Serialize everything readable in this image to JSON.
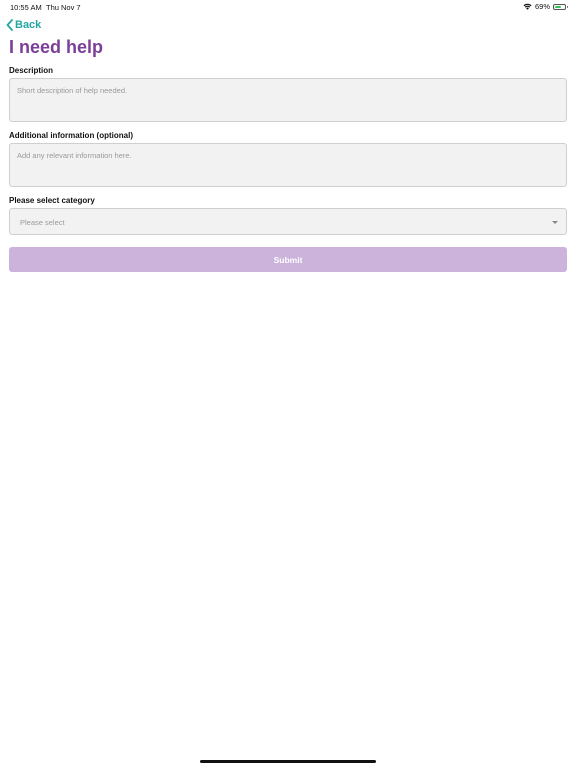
{
  "status_bar": {
    "time": "10:55 AM",
    "date": "Thu Nov 7",
    "battery_percent_label": "69%",
    "battery_level": 0.69,
    "icons": [
      "wifi-icon",
      "battery-icon"
    ]
  },
  "nav": {
    "back_label": "Back",
    "back_icon": "chevron-left-icon"
  },
  "page": {
    "title": "I need help"
  },
  "form": {
    "description": {
      "label": "Description",
      "value": "",
      "placeholder": "Short description of help needed."
    },
    "additional_info": {
      "label": "Additional information (optional)",
      "value": "",
      "placeholder": "Add any relevant information here."
    },
    "category": {
      "label": "Please select category",
      "selected": "Please select",
      "icon": "chevron-down-icon"
    },
    "submit_label": "Submit"
  },
  "colors": {
    "accent_teal": "#23a6a2",
    "title_purple": "#7b3f98",
    "submit_disabled": "#cbb3db"
  }
}
